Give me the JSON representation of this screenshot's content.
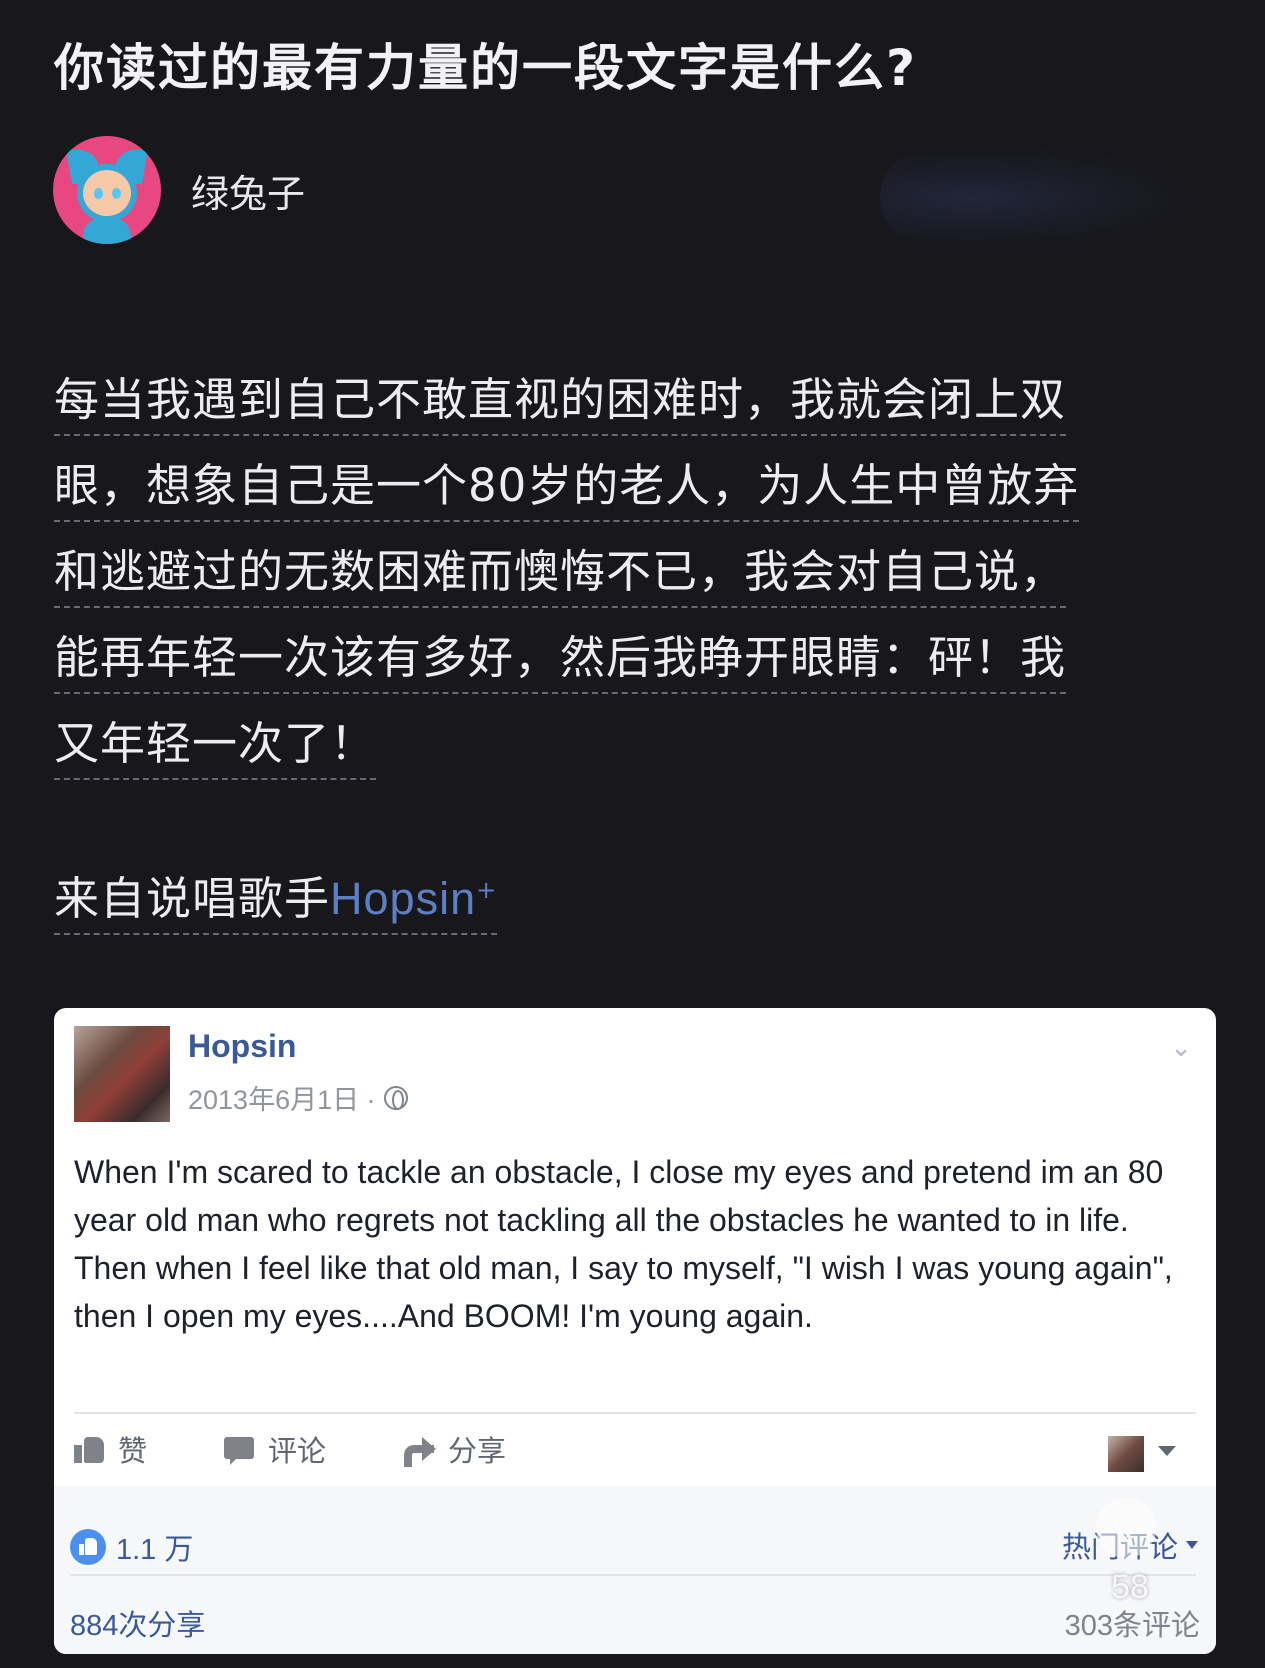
{
  "question": {
    "title": "你读过的最有力量的一段文字是什么?"
  },
  "author": {
    "name": "绿兔子",
    "avatar_icon": "cartoon-avatar-icon"
  },
  "answer": {
    "lines": [
      "每当我遇到自己不敢直视的困难时，我就会闭上双",
      "眼，想象自己是一个80岁的老人，为人生中曾放弃",
      "和逃避过的无数困难而懊悔不已，我会对自己说，",
      "能再年轻一次该有多好，然后我睁开眼睛：砰！我",
      "又年轻一次了！"
    ],
    "source_prefix": "来自说唱歌手",
    "source_link": "Hopsin",
    "link_mark": "+"
  },
  "facebook_post": {
    "author": "Hopsin",
    "date": "2013年6月1日 ·",
    "privacy_icon": "globe-icon",
    "body": "When I'm scared to tackle an obstacle, I close my eyes and pretend im an 80 year old man who regrets not tackling all the obstacles he wanted to in life. Then when I feel like that old man, I say to myself, \"I wish I was young again\", then I open my eyes....And BOOM! I'm young again.",
    "actions": {
      "like": "赞",
      "comment": "评论",
      "share": "分享"
    },
    "likes": "1.1 万",
    "hot_comments": "热门评论",
    "shares": "884次分享",
    "comments": "303条评论"
  },
  "overlay": {
    "favorite_count": "58",
    "favorite_icon": "heart-icon"
  },
  "colors": {
    "background": "#17171c",
    "link": "#5d7fc4",
    "fb_blue": "#3b5998",
    "like_badge": "#4d8ff1"
  }
}
